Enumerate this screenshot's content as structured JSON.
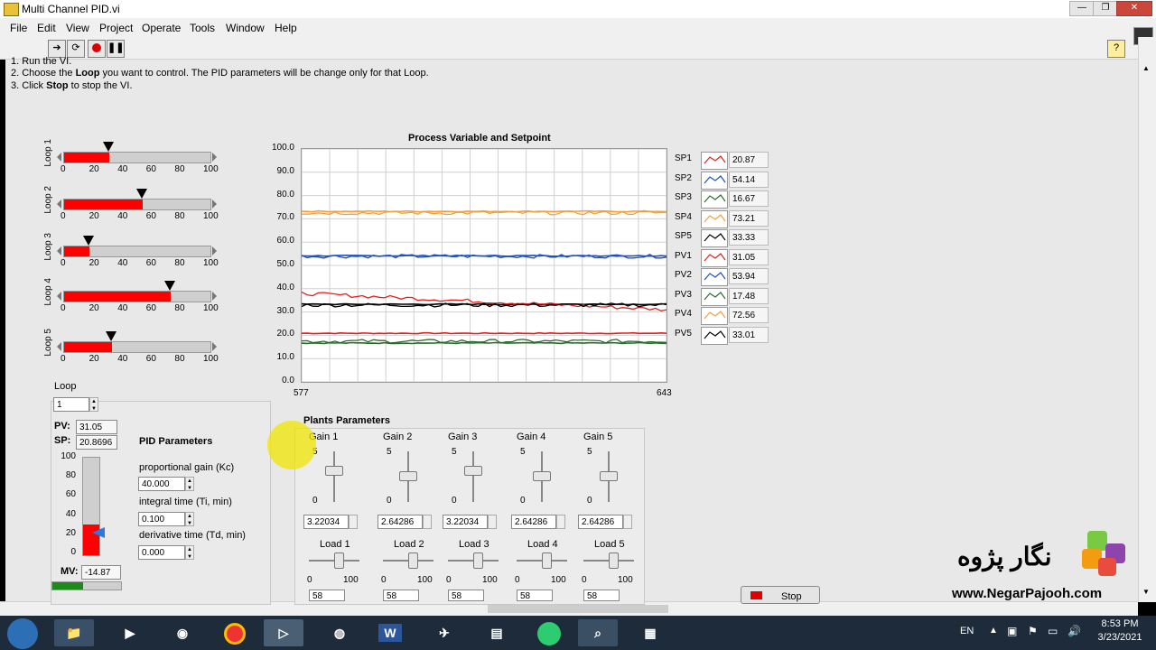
{
  "window": {
    "title": "Multi Channel PID.vi"
  },
  "menu": [
    "File",
    "Edit",
    "View",
    "Project",
    "Operate",
    "Tools",
    "Window",
    "Help"
  ],
  "instructions": {
    "line1": "1. Run the VI.",
    "line2_pre": "2. Choose the ",
    "line2_bold": "Loop",
    "line2_post": " you want to control. The PID parameters will be change only for that Loop.",
    "line3_pre": "3. Click ",
    "line3_bold": "Stop",
    "line3_post": " to stop the VI."
  },
  "loops": [
    {
      "label": "Loop 1",
      "value": 31.05
    },
    {
      "label": "Loop 2",
      "value": 53.94
    },
    {
      "label": "Loop 3",
      "value": 17.48
    },
    {
      "label": "Loop 4",
      "value": 72.56
    },
    {
      "label": "Loop 5",
      "value": 33.01
    }
  ],
  "slide_ticks": [
    "0",
    "20",
    "40",
    "60",
    "80",
    "100"
  ],
  "chart_data": {
    "type": "line",
    "title": "Process Variable and Setpoint",
    "xlim": [
      577,
      643
    ],
    "ylim": [
      0,
      100
    ],
    "x_tick_labels": [
      "577",
      "643"
    ],
    "y_tick_labels": [
      "0.0",
      "10.0",
      "20.0",
      "30.0",
      "40.0",
      "50.0",
      "60.0",
      "70.0",
      "80.0",
      "90.0",
      "100.0"
    ],
    "grid": true,
    "legend_position": "right",
    "series": [
      {
        "name": "SP1",
        "value": "20.87",
        "level": 20.87,
        "color": "#e02020"
      },
      {
        "name": "SP2",
        "value": "54.14",
        "level": 54.14,
        "color": "#1f4fbf"
      },
      {
        "name": "SP3",
        "value": "16.67",
        "level": 16.67,
        "color": "#2f6a2f"
      },
      {
        "name": "SP4",
        "value": "73.21",
        "level": 73.21,
        "color": "#f0a040"
      },
      {
        "name": "SP5",
        "value": "33.33",
        "level": 33.33,
        "color": "#000000"
      },
      {
        "name": "PV1",
        "value": "31.05",
        "level": 31.05,
        "start": 38,
        "color": "#e02020"
      },
      {
        "name": "PV2",
        "value": "53.94",
        "level": 53.94,
        "color": "#1f4fbf"
      },
      {
        "name": "PV3",
        "value": "17.48",
        "level": 17.48,
        "color": "#2f6a2f"
      },
      {
        "name": "PV4",
        "value": "72.56",
        "level": 72.56,
        "color": "#f0a040"
      },
      {
        "name": "PV5",
        "value": "33.01",
        "level": 33.01,
        "color": "#000000"
      }
    ]
  },
  "pid": {
    "loop_label": "Loop",
    "loop_value": "1",
    "pv_label": "PV:",
    "pv_value": "31.05",
    "sp_label": "SP:",
    "sp_value": "20.8696",
    "title": "PID Parameters",
    "kc_label": "proportional gain (Kc)",
    "kc_value": "40.000",
    "ti_label": "integral time (Ti, min)",
    "ti_value": "0.100",
    "td_label": "derivative time (Td, min)",
    "td_value": "0.000",
    "mv_label": "MV:",
    "mv_value": "-14.87",
    "bar_ticks": [
      "100",
      "80",
      "60",
      "40",
      "20",
      "0"
    ],
    "bar_level": 31.05
  },
  "plants": {
    "title": "Plants Parameters",
    "gains": [
      {
        "label": "Gain 1",
        "value": "3.22034",
        "level": 0.644
      },
      {
        "label": "Gain 2",
        "value": "2.64286",
        "level": 0.529
      },
      {
        "label": "Gain 3",
        "value": "3.22034",
        "level": 0.644
      },
      {
        "label": "Gain 4",
        "value": "2.64286",
        "level": 0.529
      },
      {
        "label": "Gain 5",
        "value": "2.64286",
        "level": 0.529
      }
    ],
    "gain_max": "5",
    "gain_min": "0",
    "loads": [
      {
        "label": "Load 1",
        "value": "58"
      },
      {
        "label": "Load 2",
        "value": "58"
      },
      {
        "label": "Load 3",
        "value": "58"
      },
      {
        "label": "Load 4",
        "value": "58"
      },
      {
        "label": "Load 5",
        "value": "58"
      }
    ],
    "load_min": "0",
    "load_max": "100",
    "load_level": 0.58
  },
  "stop_button": "Stop",
  "watermark": {
    "brand": "نگار پژوه",
    "url": "www.NegarPajooh.com"
  },
  "taskbar": {
    "lang": "EN",
    "time": "8:53 PM",
    "date": "3/23/2021"
  },
  "colors": {
    "fill": "#ff0000",
    "panel": "#e8e8e8",
    "taskbar": "#1d2b3a"
  }
}
